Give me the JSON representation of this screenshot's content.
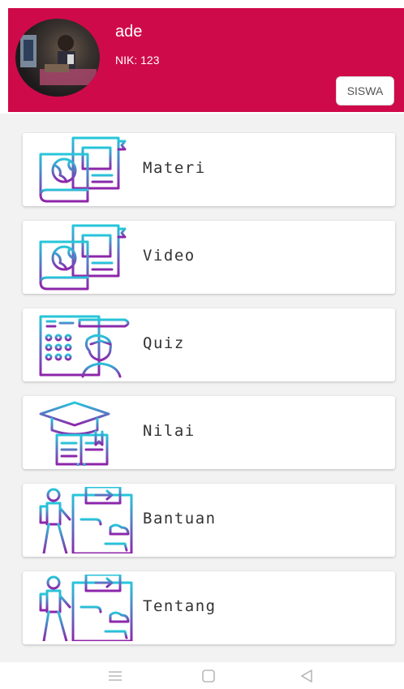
{
  "header": {
    "user_name": "ade",
    "nik": "NIK: 123",
    "role_label": "SISWA",
    "background_color": "#cf0a4a"
  },
  "menu": {
    "items": [
      {
        "label": "Materi",
        "icon": "books-globe-icon"
      },
      {
        "label": "Video",
        "icon": "books-globe-icon"
      },
      {
        "label": "Quiz",
        "icon": "quiz-student-icon"
      },
      {
        "label": "Nilai",
        "icon": "graduation-book-icon"
      },
      {
        "label": "Bantuan",
        "icon": "hiker-map-icon"
      },
      {
        "label": "Tentang",
        "icon": "hiker-map-icon"
      }
    ]
  },
  "navbar": {
    "buttons": [
      "menu-icon",
      "home-icon",
      "back-icon"
    ]
  },
  "colors": {
    "icon_gradient_start": "#26c6da",
    "icon_gradient_end": "#8e24aa"
  }
}
